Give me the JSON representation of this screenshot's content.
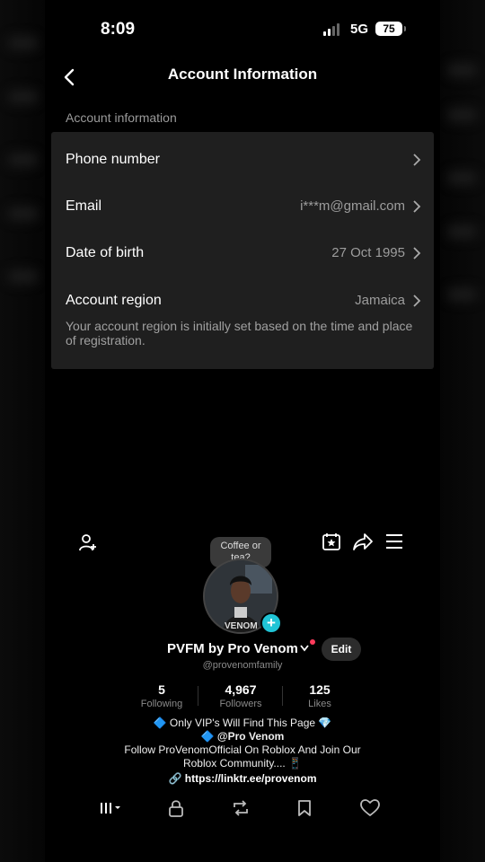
{
  "status_bar": {
    "time": "8:09",
    "network": "5G",
    "battery": "75"
  },
  "header": {
    "title": "Account Information"
  },
  "account": {
    "section_label": "Account information",
    "rows": [
      {
        "label": "Phone number",
        "value": ""
      },
      {
        "label": "Email",
        "value": "i***m@gmail.com"
      },
      {
        "label": "Date of birth",
        "value": "27 Oct 1995"
      },
      {
        "label": "Account region",
        "value": "Jamaica"
      }
    ],
    "region_note": "Your account region is initially set based on the time and place of registration."
  },
  "profile": {
    "tooltip": "Coffee or tea?",
    "name": "PVFM by Pro Venom",
    "edit_label": "Edit",
    "handle": "@provenomfamily",
    "stats": [
      {
        "value": "5",
        "label": "Following"
      },
      {
        "value": "4,967",
        "label": "Followers"
      },
      {
        "value": "125",
        "label": "Likes"
      }
    ],
    "bio": [
      "🔷 Only VIP's Will Find This Page 💎",
      "🔷 @Pro Venom",
      "Follow ProVenomOfficial On Roblox And Join Our",
      "Roblox Community.... 📱"
    ],
    "link": "https://linktr.ee/provenom"
  },
  "colors": {
    "accent": "#20c4d6",
    "card": "#1f1f1f",
    "muted": "#9d9d9d",
    "notification": "#ff3b5c"
  },
  "icons": [
    "chevron-left-icon",
    "chevron-right-icon",
    "add-friend-icon",
    "calendar-star-icon",
    "share-icon",
    "menu-icon",
    "grid-icon",
    "lock-icon",
    "repost-icon",
    "bookmark-icon",
    "heart-icon"
  ]
}
